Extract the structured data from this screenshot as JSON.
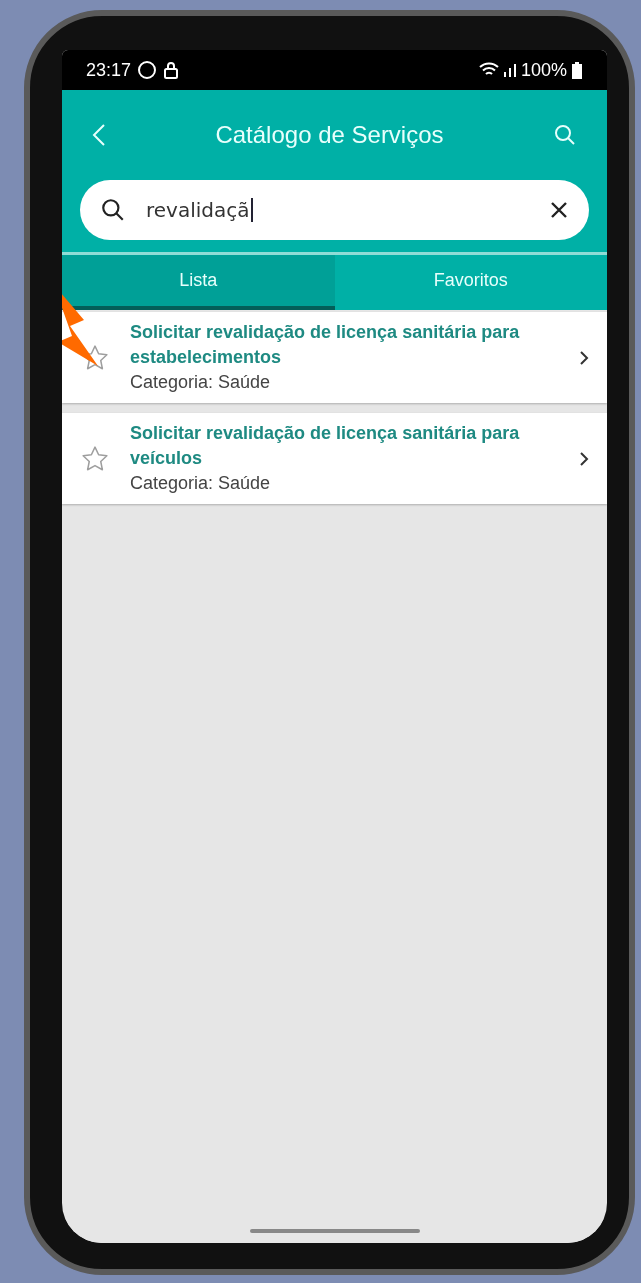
{
  "status_bar": {
    "time": "23:17",
    "battery": "100%"
  },
  "header": {
    "title": "Catálogo de Serviços"
  },
  "search": {
    "value": "revalidaçã"
  },
  "tabs": [
    {
      "label": "Lista",
      "selected": true
    },
    {
      "label": "Favoritos",
      "selected": false
    }
  ],
  "services": [
    {
      "title": "Solicitar revalidação de licença sanitária para estabelecimentos",
      "category": "Categoria: Saúde",
      "favorite": false
    },
    {
      "title": "Solicitar revalidação de licença sanitária para veículos",
      "category": "Categoria: Saúde",
      "favorite": false
    }
  ]
}
